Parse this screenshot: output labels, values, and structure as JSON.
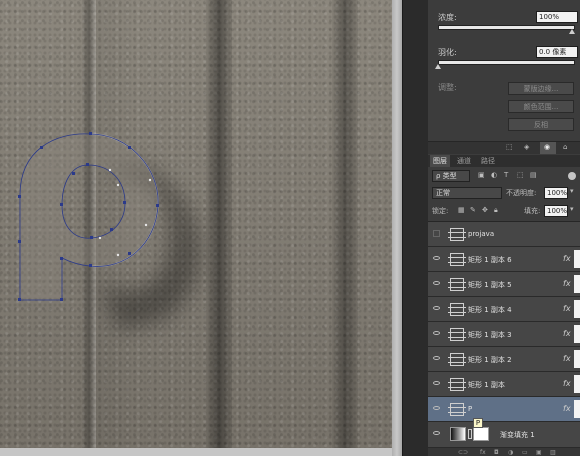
{
  "properties": {
    "density_label": "浓度:",
    "density_value": "100%",
    "feather_label": "羽化:",
    "feather_value": "0.0 像素",
    "adjust_label": "调整:",
    "buttons": [
      "蒙版边缘...",
      "颜色范围...",
      "反相"
    ]
  },
  "layers_panel": {
    "tabs": [
      "图层",
      "通道",
      "路径"
    ],
    "kind_filter": "ρ 类型",
    "blend_mode": "正常",
    "opacity_label": "不透明度:",
    "opacity_value": "100%",
    "lock_label": "锁定:",
    "fill_label": "填充:",
    "fill_value": "100%",
    "layers": [
      {
        "name": "projava",
        "visible": false,
        "fx": ""
      },
      {
        "name": "矩形 1 副本 6",
        "visible": true,
        "fx": "fx"
      },
      {
        "name": "矩形 1 副本 5",
        "visible": true,
        "fx": "fx"
      },
      {
        "name": "矩形 1 副本 4",
        "visible": true,
        "fx": "fx"
      },
      {
        "name": "矩形 1 副本 3",
        "visible": true,
        "fx": "fx"
      },
      {
        "name": "矩形 1 副本 2",
        "visible": true,
        "fx": "fx"
      },
      {
        "name": "矩形 1 副本",
        "visible": true,
        "fx": "fx"
      },
      {
        "name": "P",
        "visible": true,
        "fx": "fx",
        "selected": true
      },
      {
        "name": "渐变填充 1",
        "visible": true,
        "fx": ""
      }
    ],
    "tooltip": "P"
  },
  "colors": {
    "panel_bg": "#3c3c3c",
    "selected_layer": "#5f7087",
    "canvas_stone": "#857f75"
  }
}
